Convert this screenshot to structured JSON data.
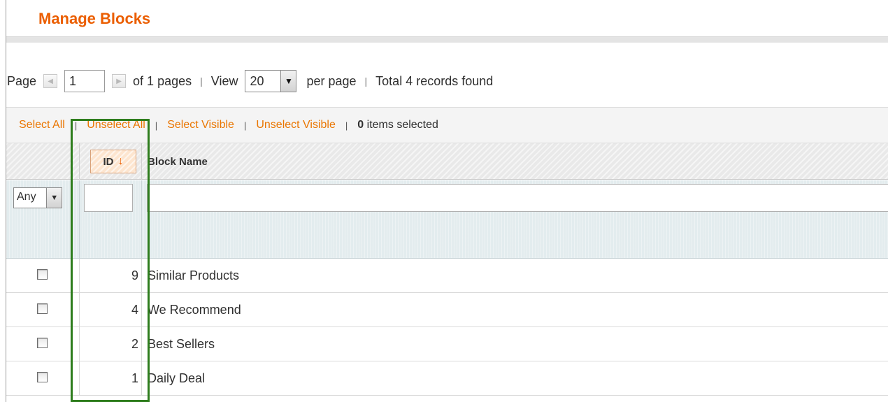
{
  "page": {
    "title": "Manage Blocks"
  },
  "pager": {
    "page_label": "Page",
    "page_value": "1",
    "of_pages": "of 1 pages",
    "view_label": "View",
    "per_page_value": "20",
    "per_page_label": "per page",
    "total": "Total 4 records found"
  },
  "massaction": {
    "select_all": "Select All",
    "unselect_all": "Unselect All",
    "select_visible": "Select Visible",
    "unselect_visible": "Unselect Visible",
    "selected_count": "0",
    "selected_suffix": "items selected"
  },
  "grid": {
    "columns": {
      "id": "ID",
      "id_sort_indicator": "↓",
      "name": "Block Name"
    },
    "filter": {
      "massaction_value": "Any",
      "id_value": "",
      "name_value": ""
    },
    "rows": [
      {
        "id": "9",
        "name": "Similar Products",
        "checked": false
      },
      {
        "id": "4",
        "name": "We Recommend",
        "checked": false
      },
      {
        "id": "2",
        "name": "Best Sellers",
        "checked": false
      },
      {
        "id": "1",
        "name": "Daily Deal",
        "checked": false
      }
    ]
  },
  "colors": {
    "accent": "#eb5e00",
    "link": "#ea7601",
    "highlight": "#2e7d1d"
  }
}
